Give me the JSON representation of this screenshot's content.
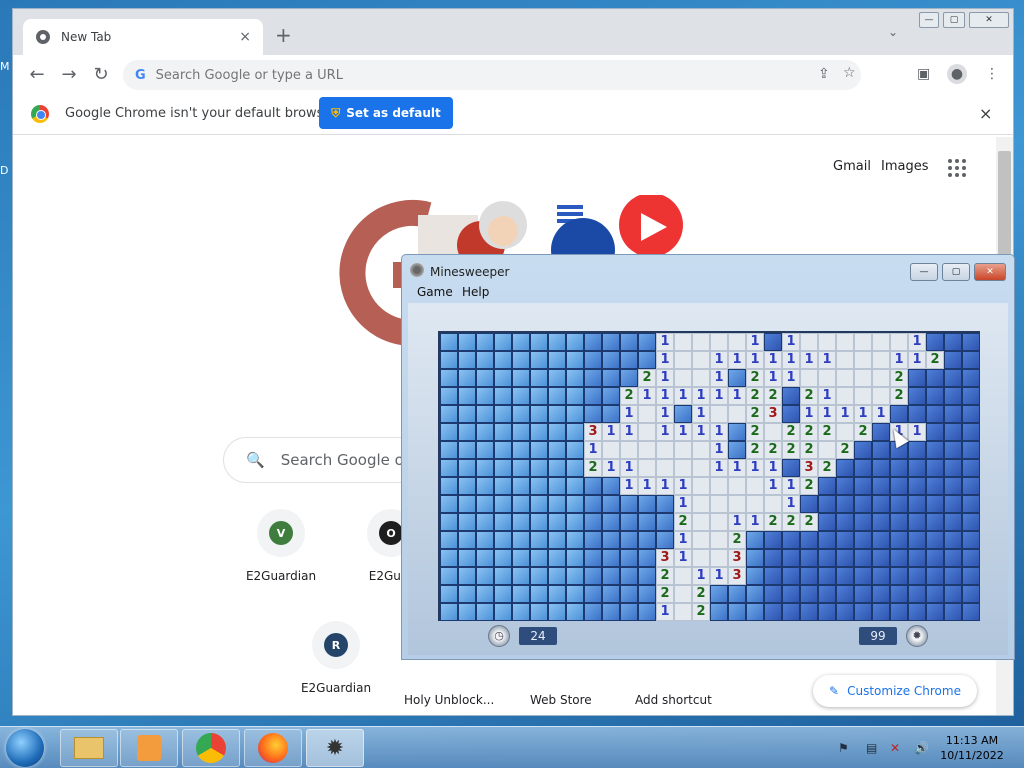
{
  "desktop": {
    "edge_letters": [
      "M",
      "D"
    ]
  },
  "browser": {
    "tab": {
      "title": "New Tab",
      "close": "×"
    },
    "new_tab": "+",
    "tab_dropdown": "⌄",
    "nav": {
      "back": "←",
      "forward": "→",
      "reload": "↻"
    },
    "omnibox": {
      "placeholder": "Search Google or type a URL",
      "value": ""
    },
    "infobar": {
      "message": "Google Chrome isn't your default browser",
      "button": "Set as default",
      "close": "×"
    },
    "links": {
      "gmail": "Gmail",
      "images": "Images"
    },
    "search": {
      "placeholder": "Search Google or"
    },
    "shortcuts": [
      {
        "label": "E2Guardian",
        "letter": "V",
        "color": "#3e7d3e"
      },
      {
        "label": "E2Guar",
        "letter": "O",
        "color": "#1e1e1e"
      },
      {
        "label": "E2Guardian",
        "letter": "R",
        "color": "#244569"
      }
    ],
    "shortcut_labels_row2": [
      "Holy Unblock...",
      "Web Store",
      "Add shortcut"
    ],
    "customize": "Customize Chrome"
  },
  "minesweeper": {
    "title": "Minesweeper",
    "menu": [
      "Game",
      "Help"
    ],
    "time": "24",
    "mines": "99",
    "board_rows": [
      "UUUUUUUUUUUU1....1U1......1UUU",
      "UUUUUUUUUUUU1..1111111...112UU",
      "UUUUUUUUUUU21..1U211.....2UUUU",
      "UUUUUUUUUU211111122U21...2UUUU",
      "UUUUUUUUUU1.1U1..23U11111UUUUU",
      "UUUUUUUU311.1111U2.222.2U11UUU",
      "UUUUUUUU1......1U2222.2UUUUUUU",
      "UUUUUUUU211....1111U32UUUUUUUU",
      "UUUUUUUUUU1111....112UUUUUUUUU",
      "UUUUUUUUUUUUU1.....1UUUUUUUUUU",
      "UUUUUUUUUUUUU2..11222UUUUUUUUU",
      "UUUUUUUUUUUUU1..2UUUUUUUUUUUUU",
      "UUUUUUUUUUUU31..3UUUUUUUUUUUUU",
      "UUUUUUUUUUUU2.113UUUUUUUUUUUUU",
      "UUUUUUUUUUUU2.2UUUUUUUUUUUUUUU",
      "UUUUUUUUUUUU1.2UUUUUUUUUUUUUUU"
    ]
  },
  "taskbar": {
    "time": "11:13 AM",
    "date": "10/11/2022"
  },
  "colors": {
    "chrome_blue": "#1a73e8",
    "desktop": "#3d97d3",
    "board_dark": "#2b4d8c"
  }
}
